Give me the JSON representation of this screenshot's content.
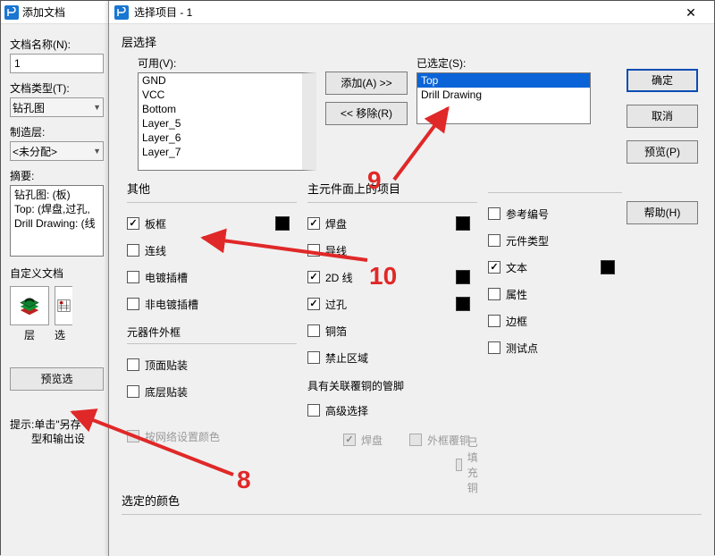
{
  "back": {
    "title": "添加文档",
    "name_label": "文档名称(N):",
    "name_value": "1",
    "type_label": "文档类型(T):",
    "type_value": "钻孔图",
    "mfg_label": "制造层:",
    "mfg_value": "<未分配>",
    "summary_label": "摘要:",
    "summary_lines": [
      "钻孔图: (板)",
      "Top: (焊盘,过孔,",
      "Drill Drawing: (线"
    ],
    "custom_label": "自定义文档",
    "icon1_lbl": "层",
    "icon2_lbl": "选",
    "preview_btn": "预览选",
    "tip_l1": "提示:单击\"另存\"",
    "tip_l2": "型和输出设"
  },
  "front": {
    "title": "选择项目 - 1",
    "close": "✕",
    "btns": {
      "ok": "确定",
      "cancel": "取消",
      "preview": "预览(P)",
      "help": "帮助(H)"
    },
    "layer_group": "层选择",
    "avail_lbl": "可用(V):",
    "avail_items": [
      "GND",
      "VCC",
      "Bottom",
      "Layer_5",
      "Layer_6",
      "Layer_7"
    ],
    "sel_lbl": "已选定(S):",
    "sel_items": [
      "Top",
      "Drill Drawing"
    ],
    "add_btn": "添加(A) >>",
    "remove_btn": "<< 移除(R)",
    "other_group": "其他",
    "other": {
      "board_outline": "板框",
      "connections": "连线",
      "plated_slots": "电镀插槽",
      "nonplated_slots": "非电镀插槽"
    },
    "comp_outline_group": "元器件外框",
    "comp_outline": {
      "top_smd": "顶面贴装",
      "bot_smd": "底层贴装"
    },
    "primary_group": "主元件面上的项目",
    "primary": {
      "pads": "焊盘",
      "traces": "导线",
      "lines2d": "2D 线",
      "vias": "过孔",
      "copper": "铜箔",
      "keepout": "禁止区域",
      "refdes": "参考编号",
      "parttype": "元件类型",
      "text": "文本",
      "attrs": "属性",
      "outline": "边框",
      "testpts": "测试点"
    },
    "assoc_group": "具有关联覆铜的管脚",
    "assoc": {
      "adv": "高级选择",
      "pads": "焊盘",
      "outer": "外框覆铜",
      "filled": "已填充铜"
    },
    "net_color": "按网络设置颜色",
    "sel_color_group": "选定的颜色"
  },
  "annotations": {
    "n8": "8",
    "n9": "9",
    "n10": "10"
  }
}
